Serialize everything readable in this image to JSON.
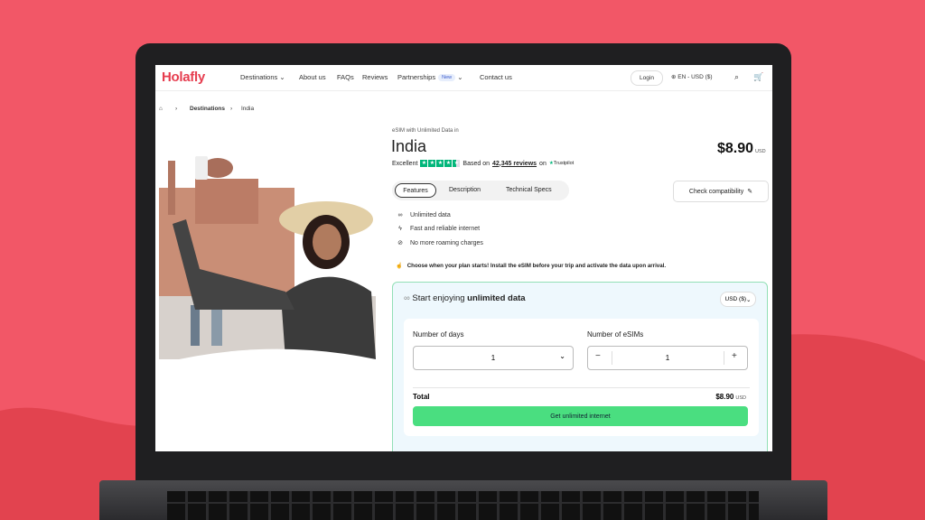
{
  "nav": {
    "logo": "Holafly",
    "links": [
      "Destinations",
      "About us",
      "FAQs",
      "Reviews",
      "Partnerships"
    ],
    "partnerships_badge": "New",
    "contact": "Contact us",
    "login": "Login",
    "language": "EN - USD ($)"
  },
  "breadcrumb": {
    "current_section": "Destinations",
    "page": "India"
  },
  "product": {
    "subtitle": "eSIM with Unlimited Data in",
    "title": "India",
    "price": "$8.90",
    "currency_code": "USD",
    "rating_text": "Excellent",
    "reviews_prefix": "Based on",
    "reviews_count": "42,345 reviews",
    "reviews_suffix": "on",
    "trustpilot": "Trustpilot",
    "stars": 4.5
  },
  "tabs": [
    "Features",
    "Description",
    "Technical Specs"
  ],
  "compatibility": "Check compatibility",
  "features": [
    "Unlimited data",
    "Fast and reliable internet",
    "No more roaming charges"
  ],
  "plan_note": "Choose when your plan starts! Install the eSIM before your trip and activate the data upon arrival.",
  "plan": {
    "head_prefix": "Start enjoying",
    "head_bold": "unlimited data",
    "currency_select": "USD ($)",
    "days_label": "Number of days",
    "days_value": "1",
    "esims_label": "Number of eSIMs",
    "esims_value": "1",
    "minus": "−",
    "plus": "+",
    "total_label": "Total",
    "total_price": "$8.90",
    "total_currency": "USD",
    "cta": "Get unlimited internet"
  },
  "colors": {
    "brand": "#e63d4f",
    "background": "#f25767",
    "cta": "#4ade80",
    "trustpilot": "#00b67a"
  }
}
